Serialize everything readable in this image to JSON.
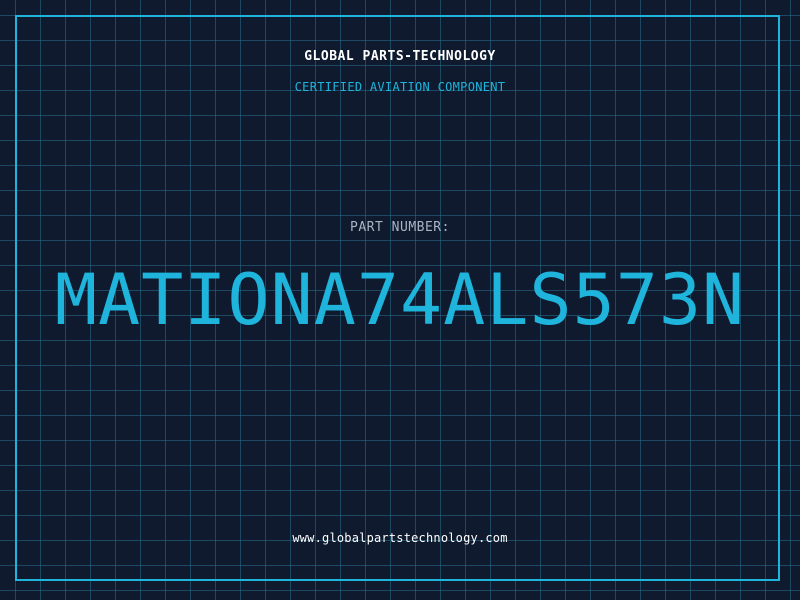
{
  "header": {
    "company": "GLOBAL PARTS-TECHNOLOGY",
    "subtitle": "CERTIFIED AVIATION COMPONENT"
  },
  "part": {
    "label": "PART NUMBER:",
    "number": "MATIONA74ALS573N"
  },
  "footer": {
    "url": "www.globalpartstechnology.com"
  },
  "colors": {
    "background": "#0f1a2e",
    "grid": "#286e8c",
    "accent": "#1eb4dc",
    "text": "#ffffff",
    "muted": "#a9b4c4"
  }
}
